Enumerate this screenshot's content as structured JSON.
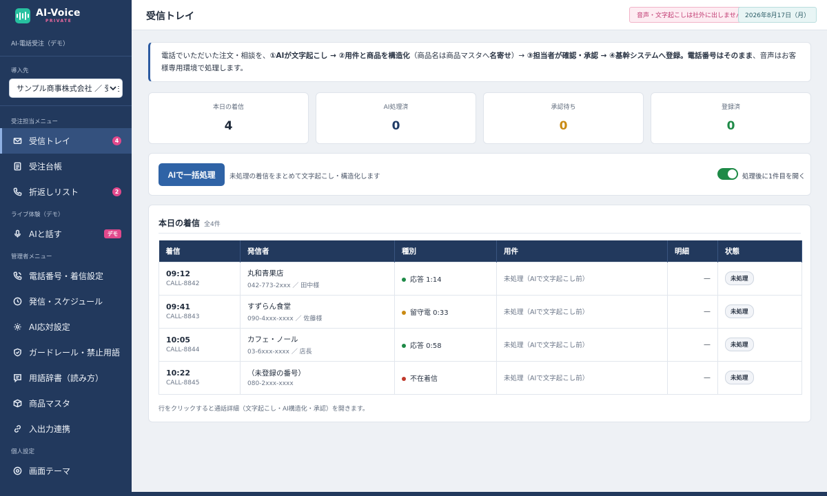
{
  "brand": {
    "name": "AI-Voice",
    "tag": "PRIVATE",
    "caption": "AI-電話受注（デモ）"
  },
  "sidebar": {
    "tenant_label": "導入先",
    "tenant_value": "サンプル商事株式会社 ／ 受注",
    "sections": {
      "order": "受注担当メニュー",
      "live": "ライブ体験（デモ）",
      "admin": "管理者メニュー",
      "personal": "個人設定"
    },
    "items": [
      {
        "label": "受信トレイ",
        "icon": "mail-icon",
        "badge": "4"
      },
      {
        "label": "受注台帳",
        "icon": "ledger-icon"
      },
      {
        "label": "折返しリスト",
        "icon": "phone-icon",
        "badge": "2"
      },
      {
        "label": "AIと話す",
        "icon": "mic-icon",
        "badge": "デモ"
      },
      {
        "label": "電話番号・着信設定",
        "icon": "phone-settings-icon"
      },
      {
        "label": "発信・スケジュール",
        "icon": "clock-icon"
      },
      {
        "label": "AI応対設定",
        "icon": "gear-icon"
      },
      {
        "label": "ガードレール・禁止用語",
        "icon": "shield-icon"
      },
      {
        "label": "用語辞書（読み方）",
        "icon": "dictionary-icon"
      },
      {
        "label": "商品マスタ",
        "icon": "box-icon"
      },
      {
        "label": "入出力連携",
        "icon": "link-icon"
      },
      {
        "label": "画面テーマ",
        "icon": "palette-icon"
      }
    ]
  },
  "header": {
    "title": "受信トレイ",
    "warning": "音声・文字起こしは社外に出しません",
    "date": "2026年8月17日（月）"
  },
  "info": {
    "p1": "電話でいただいた注文・相談を、",
    "b1": "①AIが文字起こし → ②用件と商品を構造化",
    "p2": "（商品名は商品マスタへ",
    "b2": "名寄せ",
    "p3": "）→ ",
    "b3": "③担当者が確認・承認 → ④基幹システムへ登録。電話番号はそのまま",
    "p4": "、音声はお客様専用環境で処理します。"
  },
  "stats": [
    {
      "label": "本日の着信",
      "value": "4",
      "color": "#1f2a3a"
    },
    {
      "label": "AI処理済",
      "value": "0",
      "color": "#1f3b66"
    },
    {
      "label": "承認待ち",
      "value": "0",
      "color": "#c98a12"
    },
    {
      "label": "登録済",
      "value": "0",
      "color": "#1e8a47"
    }
  ],
  "action": {
    "button": "AIで一括処理",
    "desc": "未処理の着信をまとめて文字起こし・構造化します",
    "toggle_label": "処理後に1件目を開く",
    "toggle_on": true
  },
  "calls": {
    "title": "本日の着信",
    "count": "全4件",
    "columns": [
      "着信",
      "発信者",
      "種別",
      "用件",
      "明細",
      "状態"
    ],
    "rows": [
      {
        "time": "09:12",
        "id": "CALL-8842",
        "name": "丸和青果店",
        "contact": "042-773-2xxx ／ 田中様",
        "type": "応答 1:14",
        "type_color": "#1e8a47",
        "purpose": "未処理（AIで文字起こし前）",
        "detail": "—",
        "status": "未処理"
      },
      {
        "time": "09:41",
        "id": "CALL-8843",
        "name": "すずらん食堂",
        "contact": "090-4xxx-xxxx ／ 佐藤様",
        "type": "留守電 0:33",
        "type_color": "#c98a12",
        "purpose": "未処理（AIで文字起こし前）",
        "detail": "—",
        "status": "未処理"
      },
      {
        "time": "10:05",
        "id": "CALL-8844",
        "name": "カフェ・ノール",
        "contact": "03-6xxx-xxxx ／ 店長",
        "type": "応答 0:58",
        "type_color": "#1e8a47",
        "purpose": "未処理（AIで文字起こし前）",
        "detail": "—",
        "status": "未処理"
      },
      {
        "time": "10:22",
        "id": "CALL-8845",
        "name": "（未登録の番号）",
        "contact": "080-2xxx-xxxx",
        "type": "不在着信",
        "type_color": "#c0392b",
        "purpose": "未処理（AIで文字起こし前）",
        "detail": "—",
        "status": "未処理"
      }
    ],
    "footer": "行をクリックすると通話詳細（文字起こし・AI構造化・承認）を開きます。"
  }
}
